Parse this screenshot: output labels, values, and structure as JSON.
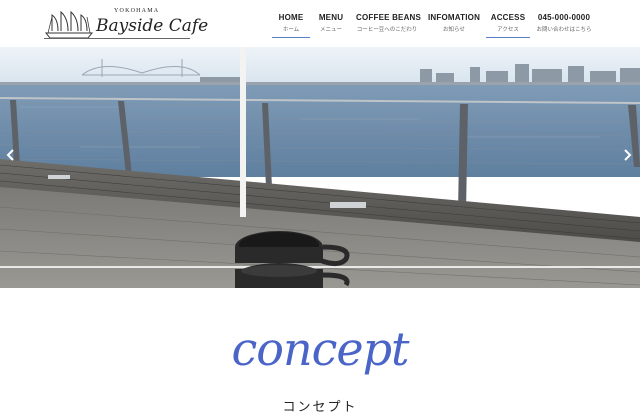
{
  "logo": {
    "subtitle": "YOKOHAMA",
    "title": "Bayside Cafe"
  },
  "nav": {
    "items": [
      {
        "en": "HOME",
        "jp": "ホーム"
      },
      {
        "en": "MENU",
        "jp": "メニュー"
      },
      {
        "en": "COFFEE BEANS",
        "jp": "コーヒー豆へのこだわり"
      },
      {
        "en": "INFOMATION",
        "jp": "お知らせ"
      },
      {
        "en": "ACCESS",
        "jp": "アクセス"
      },
      {
        "en": "045-000-0000",
        "jp": "お問い合わせはこちら"
      }
    ]
  },
  "colors": {
    "accent": "#4a64c8",
    "nav_underline": "#5b7fc6",
    "sky": "#dfe9f2",
    "sea": "#6f8fae",
    "deck": "#5e5c58"
  },
  "concept": {
    "title": "concept",
    "subtitle": "コンセプト"
  },
  "icons": {
    "logo": "sailing-ship-icon",
    "prev": "chevron-left-icon",
    "next": "chevron-right-icon"
  }
}
